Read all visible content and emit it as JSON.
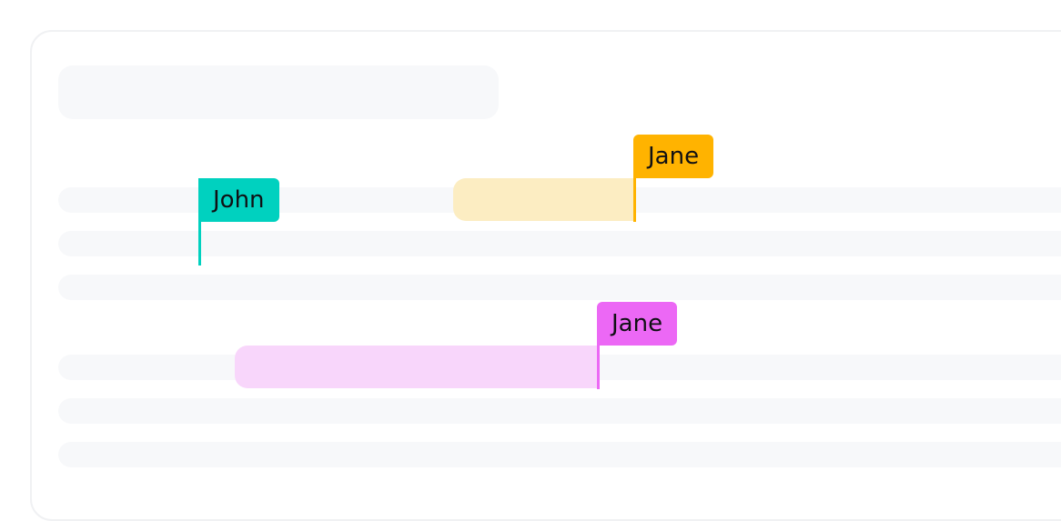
{
  "cursors": [
    {
      "name": "John",
      "color": "#00d1bf"
    },
    {
      "name": "Jane",
      "color": "#ffb300",
      "selection_color": "#fcedc2"
    },
    {
      "name": "Jane",
      "color": "#ec68f5",
      "selection_color": "#f8d6fb"
    }
  ]
}
